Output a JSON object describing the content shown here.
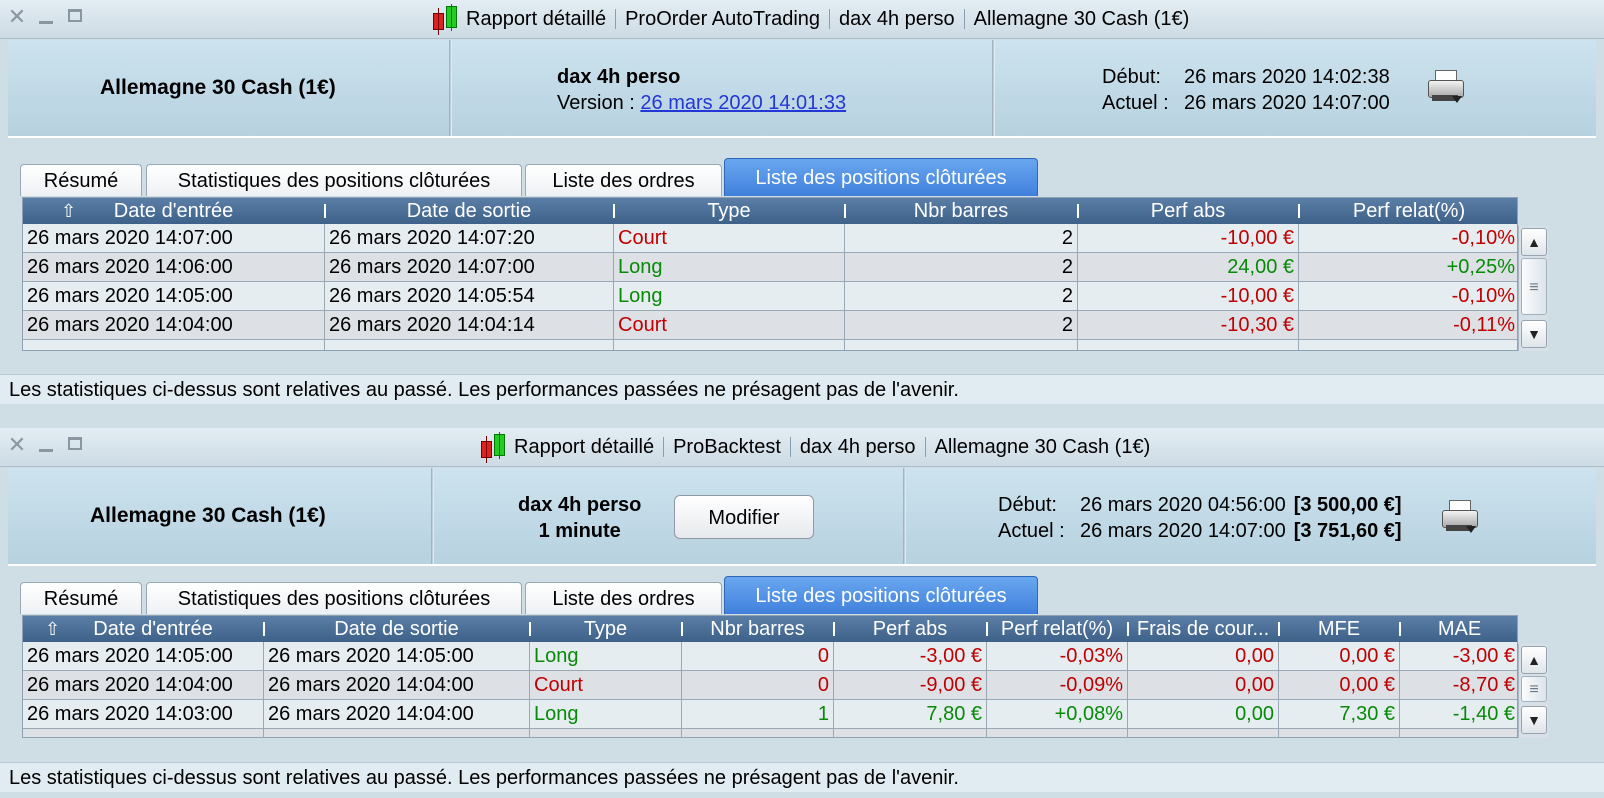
{
  "window1": {
    "title": {
      "parts": [
        "Rapport détaillé",
        "ProOrder AutoTrading",
        "dax 4h perso",
        "Allemagne 30 Cash (1€)"
      ]
    },
    "instrument": "Allemagne 30 Cash (1€)",
    "strategy": {
      "name": "dax 4h perso",
      "version_label": "Version :",
      "version_link": "26 mars 2020 14:01:33"
    },
    "dates": {
      "start_label": "Début:",
      "start_value": "26 mars 2020 14:02:38",
      "current_label": "Actuel :",
      "current_value": "26 mars 2020 14:07:00"
    },
    "tabs": [
      "Résumé",
      "Statistiques des positions clôturées",
      "Liste des ordres",
      "Liste des positions clôturées"
    ],
    "active_tab": 3,
    "columns": [
      "Date d'entrée",
      "Date de sortie",
      "Type",
      "Nbr barres",
      "Perf abs",
      "Perf relat(%)"
    ],
    "rows": [
      {
        "entry": "26 mars 2020 14:07:00",
        "exit": "26 mars 2020 14:07:20",
        "type": "Court",
        "bars": "2",
        "perf_abs": "-10,00 €",
        "perf_rel": "-0,10%",
        "color": "red"
      },
      {
        "entry": "26 mars 2020 14:06:00",
        "exit": "26 mars 2020 14:07:00",
        "type": "Long",
        "bars": "2",
        "perf_abs": "24,00 €",
        "perf_rel": "+0,25%",
        "color": "green"
      },
      {
        "entry": "26 mars 2020 14:05:00",
        "exit": "26 mars 2020 14:05:54",
        "type": "Long",
        "bars": "2",
        "perf_abs": "-10,00 €",
        "perf_rel": "-0,10%",
        "color": "red"
      },
      {
        "entry": "26 mars 2020 14:04:00",
        "exit": "26 mars 2020 14:04:14",
        "type": "Court",
        "bars": "2",
        "perf_abs": "-10,30 €",
        "perf_rel": "-0,11%",
        "color": "red"
      }
    ],
    "disclaimer": "Les statistiques ci-dessus sont relatives au passé. Les performances passées ne présagent pas de l'avenir."
  },
  "window2": {
    "title": {
      "parts": [
        "Rapport détaillé",
        "ProBacktest",
        "dax 4h perso",
        "Allemagne 30 Cash (1€)"
      ]
    },
    "instrument": "Allemagne 30 Cash (1€)",
    "strategy": {
      "name": "dax 4h perso",
      "timeframe": "1 minute",
      "modify_label": "Modifier"
    },
    "dates": {
      "start_label": "Début:",
      "start_value": "26 mars 2020 04:56:00",
      "start_amount": "[3 500,00 €]",
      "current_label": "Actuel :",
      "current_value": "26 mars 2020 14:07:00",
      "current_amount": "[3 751,60 €]"
    },
    "tabs": [
      "Résumé",
      "Statistiques des positions clôturées",
      "Liste des ordres",
      "Liste des positions clôturées"
    ],
    "active_tab": 3,
    "columns": [
      "Date d'entrée",
      "Date de sortie",
      "Type",
      "Nbr barres",
      "Perf abs",
      "Perf relat(%)",
      "Frais de cour...",
      "MFE",
      "MAE"
    ],
    "rows": [
      {
        "entry": "26 mars 2020 14:05:00",
        "exit": "26 mars 2020 14:05:00",
        "type": "Long",
        "bars": "0",
        "perf_abs": "-3,00 €",
        "perf_rel": "-0,03%",
        "fees": "0,00",
        "mfe": "0,00 €",
        "mae": "-3,00 €",
        "color": "red"
      },
      {
        "entry": "26 mars 2020 14:04:00",
        "exit": "26 mars 2020 14:04:00",
        "type": "Court",
        "bars": "0",
        "perf_abs": "-9,00 €",
        "perf_rel": "-0,09%",
        "fees": "0,00",
        "mfe": "0,00 €",
        "mae": "-8,70 €",
        "color": "red"
      },
      {
        "entry": "26 mars 2020 14:03:00",
        "exit": "26 mars 2020 14:04:00",
        "type": "Long",
        "bars": "1",
        "perf_abs": "7,80 €",
        "perf_rel": "+0,08%",
        "fees": "0,00",
        "mfe": "7,30 €",
        "mae": "-1,40 €",
        "color": "green"
      }
    ],
    "disclaimer": "Les statistiques ci-dessus sont relatives au passé. Les performances passées ne présagent pas de l'avenir."
  },
  "colors": {
    "loss": "#c00000",
    "gain": "#078a07",
    "active_tab": "#4a8be4",
    "grid_header": "#4a6d95",
    "link": "#2337d6"
  },
  "icons": [
    "close-icon",
    "minimize-icon",
    "maximize-icon",
    "candlestick-app-icon",
    "printer-icon",
    "sort-up-icon",
    "scroll-up-icon",
    "scroll-down-icon"
  ]
}
